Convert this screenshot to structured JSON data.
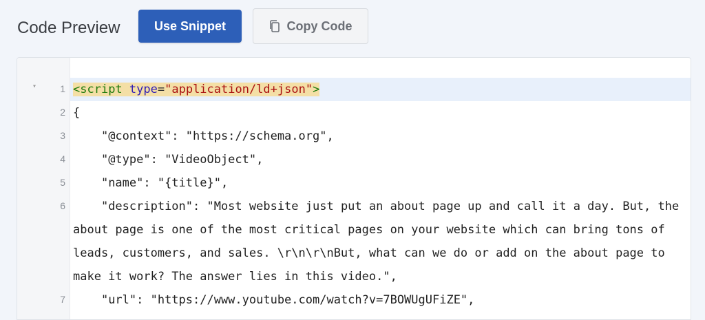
{
  "header": {
    "title": "Code Preview",
    "use_snippet_label": "Use Snippet",
    "copy_code_label": "Copy Code"
  },
  "editor": {
    "line1": {
      "num": "1",
      "open": "<",
      "tag": "script",
      "space": " ",
      "attr": "type",
      "eq": "=",
      "val": "\"application/ld+json\"",
      "close": ">"
    },
    "lines": [
      {
        "num": "2",
        "text": "{"
      },
      {
        "num": "3",
        "text": "    \"@context\": \"https://schema.org\","
      },
      {
        "num": "4",
        "text": "    \"@type\": \"VideoObject\","
      },
      {
        "num": "5",
        "text": "    \"name\": \"{title}\","
      },
      {
        "num": "6",
        "text": "    \"description\": \"Most website just put an about page up and call it a day. But, the about page is one of the most critical pages on your website which can bring tons of leads, customers, and sales. \\r\\n\\r\\nBut, what can we do or add on the about page to make it work? The answer lies in this video.\","
      },
      {
        "num": "7",
        "text": "    \"url\": \"https://www.youtube.com/watch?v=7BOWUgUFiZE\","
      }
    ],
    "fold_glyph": "▾"
  },
  "colors": {
    "primary": "#2d5fb8",
    "active_line": "#e8f0fb",
    "tag_highlight": "#f4dfa6"
  },
  "icons": {
    "copy": "copy-icon",
    "fold": "fold-arrow-icon"
  }
}
